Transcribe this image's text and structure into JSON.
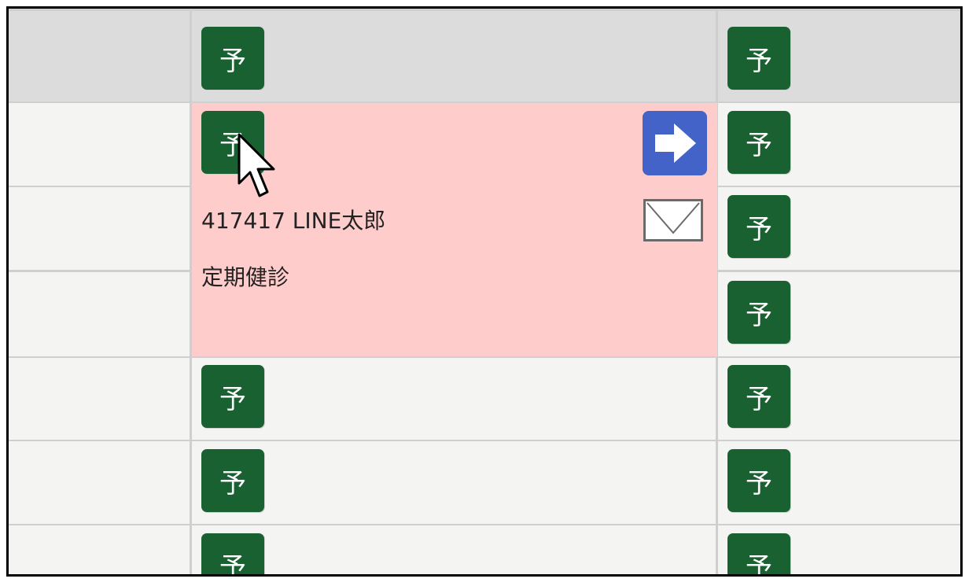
{
  "reserve_button": {
    "label": "予",
    "color": "#1a6132"
  },
  "appointment": {
    "patient": "417417 LINE太郎",
    "type": "定期健診",
    "background": "#ffcccc",
    "move_icon": "right-arrow-icon",
    "mail_icon": "envelope-icon"
  },
  "slots": {
    "column_1": [
      "予",
      "予",
      "予",
      "予",
      "予",
      "予",
      "予"
    ],
    "column_2": [
      "予",
      "予",
      "予",
      "予",
      "予",
      "予",
      "予"
    ]
  }
}
